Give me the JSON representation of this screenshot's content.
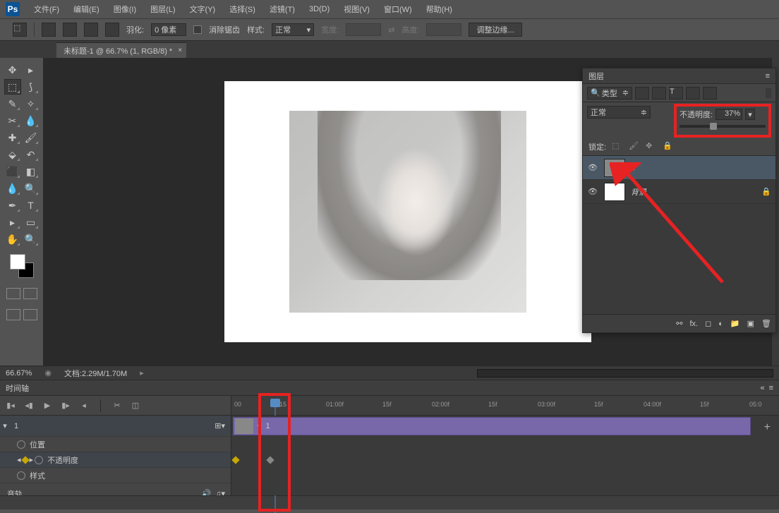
{
  "menu": {
    "file": "文件(F)",
    "edit": "编辑(E)",
    "image": "图像(I)",
    "layer": "图层(L)",
    "type": "文字(Y)",
    "select": "选择(S)",
    "filter": "滤镜(T)",
    "threed": "3D(D)",
    "view": "视图(V)",
    "window": "窗口(W)",
    "help": "帮助(H)"
  },
  "opts": {
    "feather_label": "羽化:",
    "feather_val": "0 像素",
    "antialias": "消除锯齿",
    "style_label": "样式:",
    "style_val": "正常",
    "width_label": "宽度:",
    "swap": "⇄",
    "height_label": "高度:",
    "refine": "调整边缘..."
  },
  "doc_tab": "未标题-1 @ 66.7% (1, RGB/8) *",
  "status": {
    "zoom": "66.67%",
    "doc_label": "文档:",
    "doc_size": "2.29M/1.70M"
  },
  "timeline": {
    "title": "时间轴",
    "ruler": [
      "00",
      "15",
      "01:00f",
      "15f",
      "02:00f",
      "15f",
      "03:00f",
      "15f",
      "04:00f",
      "15f",
      "05:0"
    ],
    "layer_name": "1",
    "clip_name": "1",
    "prop_pos": "位置",
    "prop_opacity": "不透明度",
    "prop_style": "样式",
    "audio": "音轨"
  },
  "layers": {
    "title": "图层",
    "filter_type": "类型",
    "blend": "正常",
    "opacity_label": "不透明度:",
    "opacity_val": "37%",
    "lock_label": "锁定:",
    "layer1": "1",
    "layer_bg": "背景"
  }
}
